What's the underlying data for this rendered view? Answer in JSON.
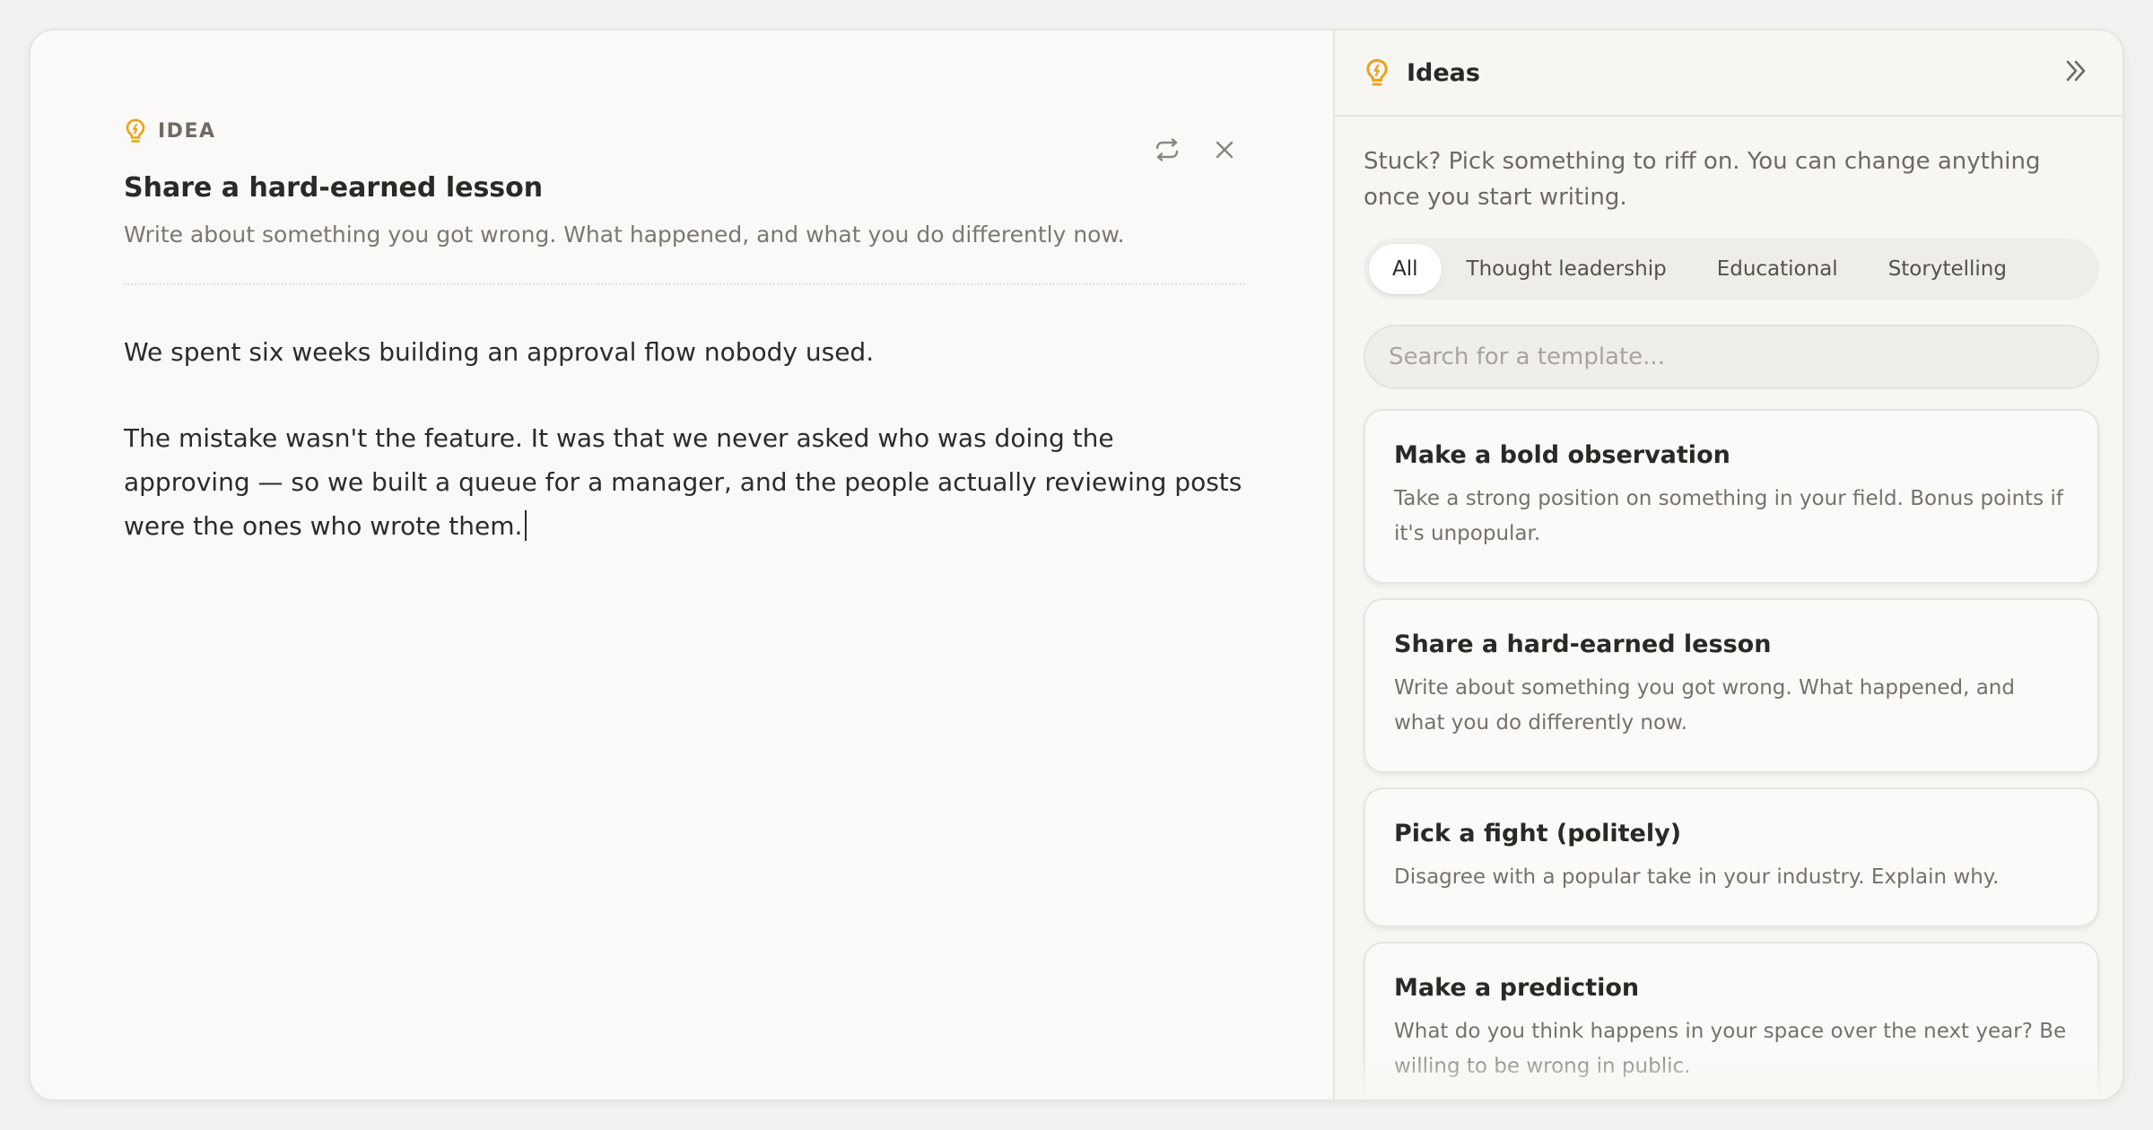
{
  "editor": {
    "idea_label": "IDEA",
    "title": "Share a hard-earned lesson",
    "description": "Write about something you got wrong. What happened, and what you do differently now.",
    "draft": [
      "We spent six weeks building an approval flow nobody used.",
      "The mistake wasn't the feature. It was that we never asked who was doing the approving — so we built a queue for a manager, and the people actually reviewing posts were the ones who wrote them."
    ],
    "icons": {
      "idea": "lightbulb-icon",
      "refresh": "refresh-icon",
      "close": "close-icon"
    }
  },
  "panel": {
    "title": "Ideas",
    "intro": "Stuck? Pick something to riff on. You can change anything once you start writing.",
    "tabs": [
      {
        "label": "All",
        "active": true
      },
      {
        "label": "Thought leadership",
        "active": false
      },
      {
        "label": "Educational",
        "active": false
      },
      {
        "label": "Storytelling",
        "active": false
      }
    ],
    "search": {
      "placeholder": "Search for a template..."
    },
    "cards": [
      {
        "title": "Make a bold observation",
        "description": "Take a strong position on something in your field. Bonus points if it's unpopular."
      },
      {
        "title": "Share a hard-earned lesson",
        "description": "Write about something you got wrong. What happened, and what you do differently now."
      },
      {
        "title": "Pick a fight (politely)",
        "description": "Disagree with a popular take in your industry. Explain why."
      },
      {
        "title": "Make a prediction",
        "description": "What do you think happens in your space over the next year? Be willing to be wrong in public."
      }
    ],
    "icons": {
      "ideas": "lightbulb-icon",
      "collapse": "double-chevron-right-icon"
    }
  },
  "colors": {
    "accent": "#e9a21a",
    "background": "#faf9f7",
    "panel": "#f7f6f3"
  }
}
